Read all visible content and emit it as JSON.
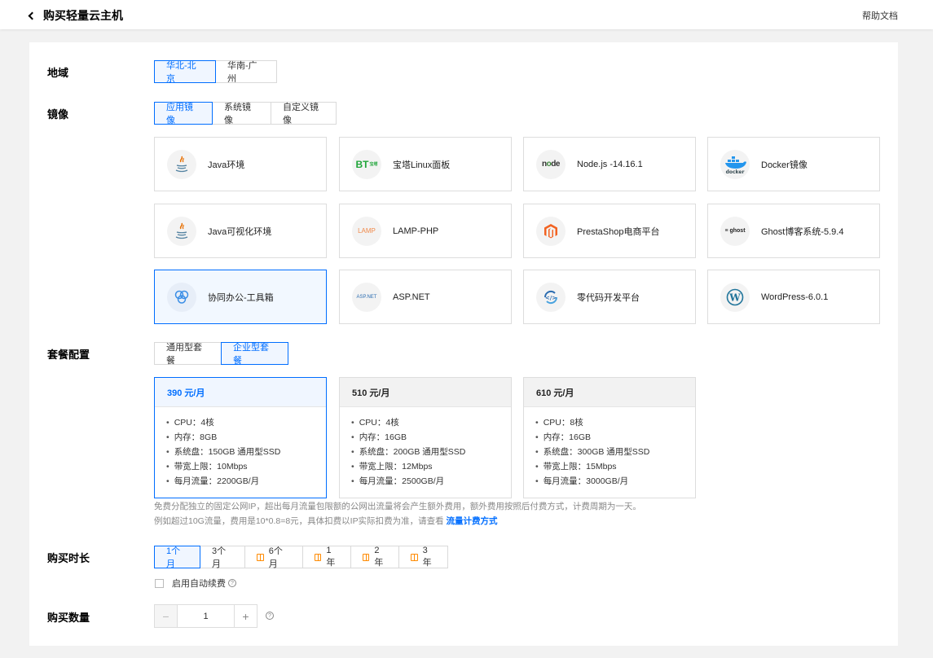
{
  "header": {
    "title": "购买轻量云主机",
    "help": "帮助文档"
  },
  "labels": {
    "region": "地域",
    "image": "镜像",
    "package": "套餐配置",
    "duration": "购买时长",
    "quantity": "购买数量"
  },
  "region": {
    "options": [
      "华北-北京",
      "华南-广州"
    ],
    "selected": "华北-北京"
  },
  "image_tabs": {
    "options": [
      "应用镜像",
      "系统镜像",
      "自定义镜像"
    ],
    "selected": "应用镜像"
  },
  "images": [
    {
      "name": "Java环境",
      "icon": "java-icon"
    },
    {
      "name": "宝塔Linux面板",
      "icon": "bt-icon"
    },
    {
      "name": "Node.js -14.16.1",
      "icon": "node-icon"
    },
    {
      "name": "Docker镜像",
      "icon": "docker-icon"
    },
    {
      "name": "Java可视化环境",
      "icon": "java-icon"
    },
    {
      "name": "LAMP-PHP",
      "icon": "lamp-icon"
    },
    {
      "name": "PrestaShop电商平台",
      "icon": "magento-icon"
    },
    {
      "name": "Ghost博客系统-5.9.4",
      "icon": "ghost-icon"
    },
    {
      "name": "协同办公-工具箱",
      "icon": "collab-icon"
    },
    {
      "name": "ASP.NET",
      "icon": "aspnet-icon"
    },
    {
      "name": "零代码开发平台",
      "icon": "lowcode-icon"
    },
    {
      "name": "WordPress-6.0.1",
      "icon": "wordpress-icon"
    }
  ],
  "selected_image": "协同办公-工具箱",
  "package_tabs": {
    "options": [
      "通用型套餐",
      "企业型套餐"
    ],
    "selected": "企业型套餐"
  },
  "plans": [
    {
      "price": "390 元/月",
      "specs": [
        "CPU：4核",
        "内存：8GB",
        "系统盘：150GB 通用型SSD",
        "带宽上限：10Mbps",
        "每月流量：2200GB/月"
      ]
    },
    {
      "price": "510 元/月",
      "specs": [
        "CPU：4核",
        "内存：16GB",
        "系统盘：200GB 通用型SSD",
        "带宽上限：12Mbps",
        "每月流量：2500GB/月"
      ]
    },
    {
      "price": "610 元/月",
      "specs": [
        "CPU：8核",
        "内存：16GB",
        "系统盘：300GB 通用型SSD",
        "带宽上限：15Mbps",
        "每月流量：3000GB/月"
      ]
    }
  ],
  "selected_plan": "390 元/月",
  "note": {
    "line1": "免费分配独立的固定公网IP，超出每月流量包限额的公网出流量将会产生额外费用，额外费用按照后付费方式，计费周期为一天。",
    "line2": "例如超过10G流量，费用是10*0.8=8元，具体扣费以IP实际扣费为准，请查看",
    "link": "流量计费方式"
  },
  "duration": {
    "options": [
      {
        "label": "1个月",
        "gift": false
      },
      {
        "label": "3个月",
        "gift": false
      },
      {
        "label": "6个月",
        "gift": true
      },
      {
        "label": "1年",
        "gift": true
      },
      {
        "label": "2年",
        "gift": true
      },
      {
        "label": "3年",
        "gift": true
      }
    ],
    "selected": "1个月"
  },
  "auto_renew": {
    "label": "启用自动续费",
    "checked": false
  },
  "quantity": {
    "value": "1",
    "minus": "−",
    "plus": "+"
  },
  "colors": {
    "accent": "#006eff",
    "gift": "#ff8a00"
  }
}
